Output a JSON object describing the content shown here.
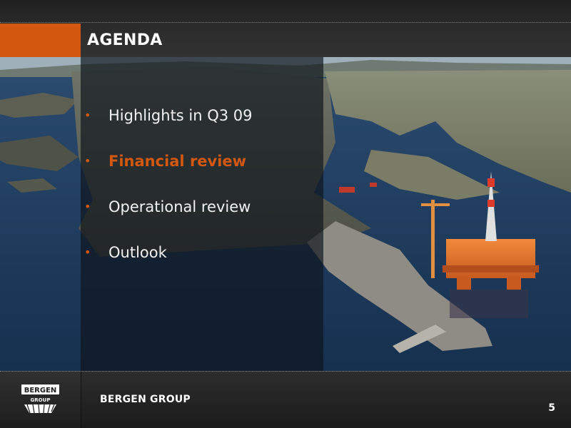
{
  "slide": {
    "title": "AGENDA",
    "agenda_items": [
      {
        "label": "Highlights in Q3 09",
        "active": false
      },
      {
        "label": "Financial review",
        "active": true
      },
      {
        "label": "Operational review",
        "active": false
      },
      {
        "label": "Outlook",
        "active": false
      }
    ],
    "bullet_glyph": "•",
    "footer": {
      "company_name": "BERGEN GROUP",
      "logo_text_top": "BERGEN",
      "logo_text_bottom": "GROUP",
      "page_number": "5"
    },
    "colors": {
      "accent": "#d2570f",
      "header_bg": "#2a2a2a",
      "footer_bg": "#1e1e1e",
      "text": "#f2f2f2"
    },
    "background_image": "aerial photo of harbour with oil platform"
  }
}
